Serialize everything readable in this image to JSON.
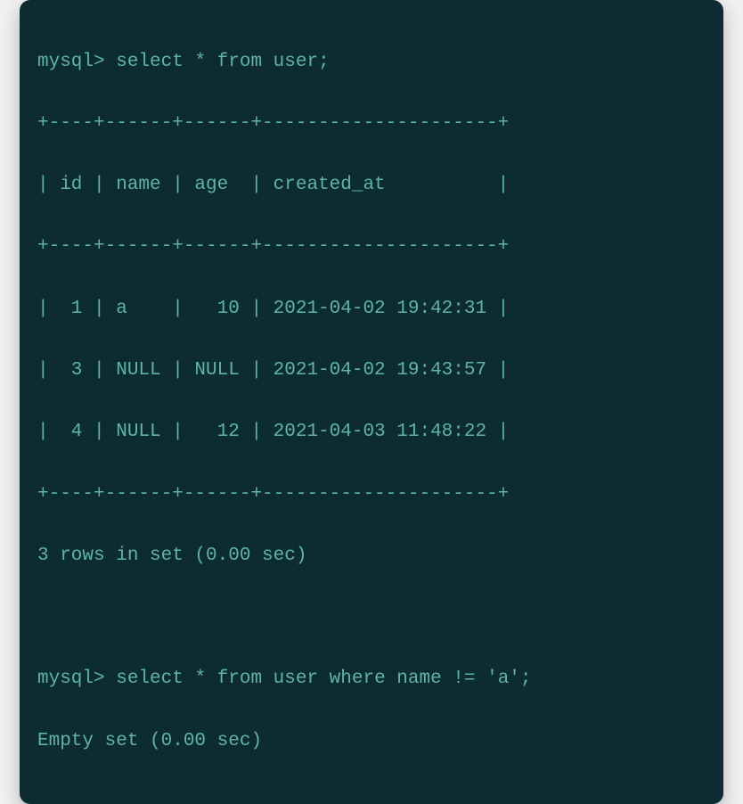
{
  "terminal": {
    "prompt": "mysql>",
    "query1": "select * from user;",
    "border": "+----+------+------+---------------------+",
    "header": "| id | name | age  | created_at          |",
    "rows": [
      "|  1 | a    |   10 | 2021-04-02 19:42:31 |",
      "|  3 | NULL | NULL | 2021-04-02 19:43:57 |",
      "|  4 | NULL |   12 | 2021-04-03 11:48:22 |"
    ],
    "result1": "3 rows in set (0.00 sec)",
    "query2": "select * from user where name != 'a';",
    "result2": "Empty set (0.00 sec)"
  },
  "chart_data": {
    "type": "table",
    "title": "user",
    "columns": [
      "id",
      "name",
      "age",
      "created_at"
    ],
    "data": [
      {
        "id": 1,
        "name": "a",
        "age": 10,
        "created_at": "2021-04-02 19:42:31"
      },
      {
        "id": 3,
        "name": null,
        "age": null,
        "created_at": "2021-04-02 19:43:57"
      },
      {
        "id": 4,
        "name": null,
        "age": 12,
        "created_at": "2021-04-03 11:48:22"
      }
    ],
    "queries": [
      {
        "sql": "select * from user;",
        "rows_returned": 3,
        "time_sec": 0.0
      },
      {
        "sql": "select * from user where name != 'a';",
        "rows_returned": 0,
        "time_sec": 0.0
      }
    ]
  }
}
